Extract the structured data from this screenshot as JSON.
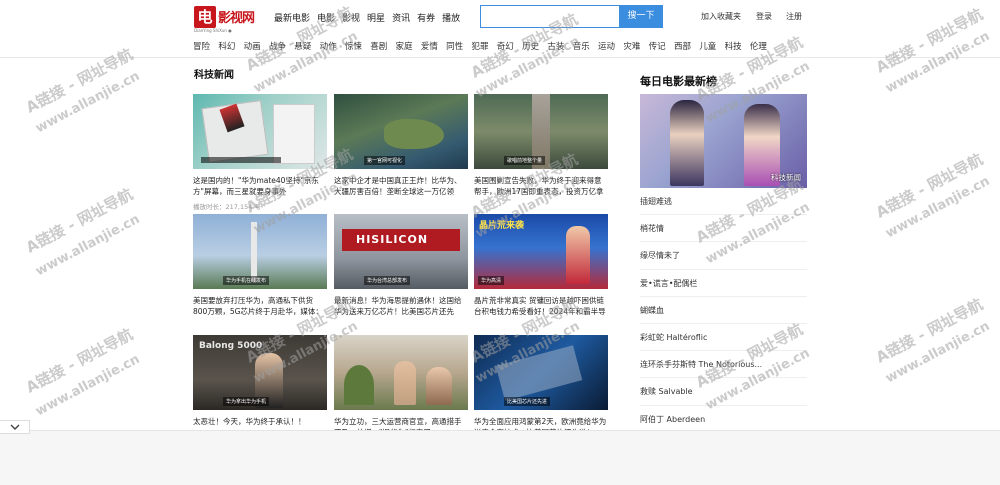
{
  "logo": {
    "mark": "电",
    "name": "影视网",
    "sub": "DianYing ShiXun ●"
  },
  "topnav": [
    "最新电影",
    "电影",
    "影视",
    "明星",
    "资讯",
    "有券",
    "播放"
  ],
  "search": {
    "placeholder": "",
    "button": "搜一下"
  },
  "user_links": [
    "加入收藏夹",
    "登录",
    "注册"
  ],
  "categories": [
    "冒险",
    "科幻",
    "动画",
    "战争",
    "悬疑",
    "动作",
    "惊悚",
    "喜剧",
    "家庭",
    "爱情",
    "同性",
    "犯罪",
    "奇幻",
    "历史",
    "古装",
    "音乐",
    "运动",
    "灾难",
    "传记",
    "西部",
    "儿童",
    "科技",
    "伦理"
  ],
  "section_title": "科技新闻",
  "cards": [
    {
      "caption": "这是国内的！\"华为mate40坚持\"京东方\"屏幕，而三星就要身事外",
      "meta": "播放时长：217,154 号"
    },
    {
      "caption": "这家中企才是中国真正王炸！比华为、大疆厉害百倍！垄断全球这一万亿领域！美国拿它毫无办法",
      "meta": ""
    },
    {
      "caption": "美国围剿宣告失败，华为终于迎来得意帮手，欧洲17国即重表态，投资万亿拿下中国市场！",
      "meta": ""
    },
    {
      "caption": "美国要放弃打压华为，高通私下供货800万颗，5G芯片终于月赴华，媒体：白宫有麻手！",
      "meta": ""
    },
    {
      "caption": "最新消息！华为海思提前遇休！这国给华为送来万亿芯片！比美国芯片还先进！美国万万没想到！",
      "meta": ""
    },
    {
      "caption": "晶片荒非常真实 贸镛回访是越吓困供链 台积电钱力希受看好！2024年和霸半导体？抢建大作战！澳洲拍卖便矿...",
      "meta": ""
    },
    {
      "caption": "太恶壮！今天，华为终于承认！！",
      "meta": ""
    },
    {
      "caption": "华为立功，三大运营商官宣，高通措手不及，外媒：\"旧华为\"归来了",
      "meta": ""
    },
    {
      "caption": "华为全面应用鸿蒙第2天，欧洲竟给华为送来全套技术，比美国芯片还先进！",
      "meta": ""
    }
  ],
  "thumb_labels": [
    "",
    "第一官网可视化",
    "歌唱前地整个量",
    "华为手机在线发布",
    "华为台湾总部发布",
    "华为高清",
    "华为拿出华为手机",
    "",
    "比美国芯片还先进"
  ],
  "thumb_overlay_texts": {
    "hisilicon": "HISILICON",
    "balong": "Balong 5000",
    "news": "晶片荒来袭"
  },
  "sidebar": {
    "title": "每日电影最新榜",
    "poster_label": "科技新闻",
    "items": [
      "插翅难逃",
      "梢花情",
      "缘尽情未了",
      "爱•谎言•配偶栏",
      "蝴蝶血",
      "彩虹蛇 Haltéroflic",
      "连环杀手芬斯特 The Notorious...",
      "救赎 Salvable",
      "阿伯丁 Aberdeen"
    ]
  },
  "watermark": {
    "line1": "A链接 - 网址导航",
    "line2": "www.allanjie.cn"
  },
  "colors": {
    "accent": "#3b8de0",
    "brand": "#c8161d"
  }
}
